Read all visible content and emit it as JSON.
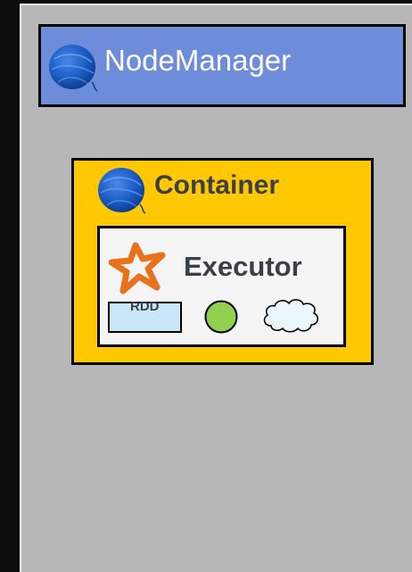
{
  "node_manager": {
    "title": "NodeManager",
    "header_color": "#6d8ddb"
  },
  "container": {
    "title": "Container",
    "fill_color": "#ffc800"
  },
  "executor": {
    "title": "Executor",
    "items": {
      "rdd_label": "RDD",
      "task_color": "#92d050",
      "cache_fill": "#eaf6fb"
    }
  },
  "icons": [
    "yarn-ball-icon",
    "spark-star-icon",
    "cloud-icon"
  ]
}
